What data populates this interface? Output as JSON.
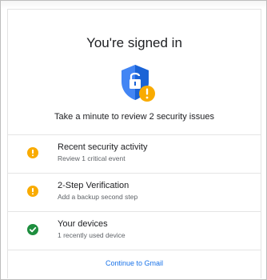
{
  "card": {
    "title": "You're signed in",
    "subtitle": "Take a minute to review 2 security issues"
  },
  "items": [
    {
      "title": "Recent security activity",
      "subtitle": "Review 1 critical event",
      "status": "warning",
      "icon": "warning-icon"
    },
    {
      "title": "2-Step Verification",
      "subtitle": "Add a backup second step",
      "status": "warning",
      "icon": "warning-icon"
    },
    {
      "title": "Your devices",
      "subtitle": "1 recently used device",
      "status": "ok",
      "icon": "check-icon"
    }
  ],
  "footer": {
    "continue_label": "Continue to Gmail"
  },
  "colors": {
    "shield_blue": "#4285f4",
    "shield_blue_dark": "#1a63d6",
    "warning_yellow": "#f9ab00",
    "ok_green": "#1e8e3e",
    "link_blue": "#1a73e8"
  }
}
